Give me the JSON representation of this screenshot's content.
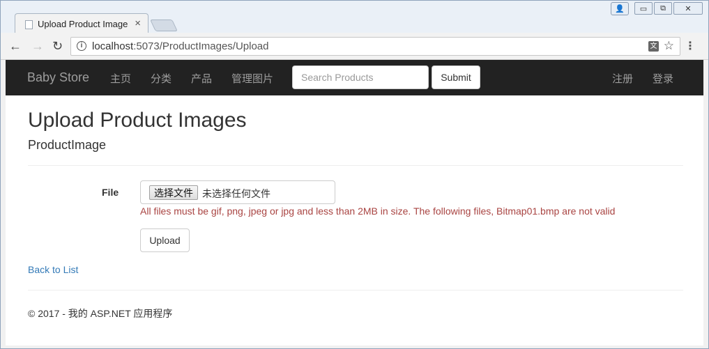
{
  "browser": {
    "tab_title": "Upload Product Images",
    "tab_close": "×",
    "url_host": "localhost",
    "url_rest": ":5073/ProductImages/Upload",
    "back": "←",
    "forward": "→",
    "reload": "↻",
    "info": "i",
    "translate": "文",
    "star": "☆",
    "menu": "⋮",
    "window": {
      "user": "👤",
      "minimize": "▭",
      "maximize": "⧉",
      "close": "✕"
    }
  },
  "navbar": {
    "brand": "Baby Store",
    "links": [
      "主页",
      "分类",
      "产品",
      "管理图片"
    ],
    "search_placeholder": "Search Products",
    "submit_label": "Submit",
    "right_links": [
      "注册",
      "登录"
    ]
  },
  "page": {
    "title": "Upload Product Images",
    "subtitle": "ProductImage",
    "file_label": "File",
    "choose_button": "选择文件",
    "no_file_text": "未选择任何文件",
    "error_message": "All files must be gif, png, jpeg or jpg and less than 2MB in size. The following files, Bitmap01.bmp are not valid",
    "upload_label": "Upload",
    "back_link": "Back to List",
    "footer": "© 2017 - 我的 ASP.NET 应用程序"
  }
}
